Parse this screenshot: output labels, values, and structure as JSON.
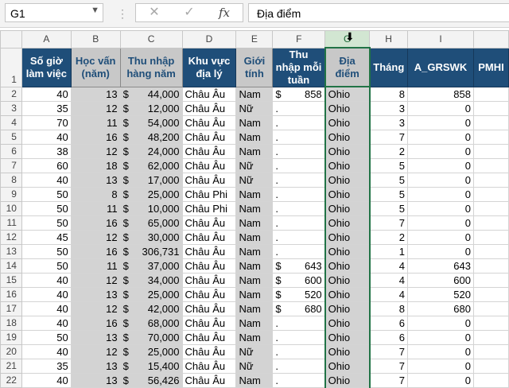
{
  "name_box": {
    "value": "G1"
  },
  "formula_bar": {
    "value": "Địa điểm",
    "fx_label": "fx",
    "cancel_icon": "cancel-x-icon",
    "enter_icon": "check-icon"
  },
  "column_letters": [
    "A",
    "B",
    "C",
    "D",
    "E",
    "F",
    "G",
    "H",
    "I",
    ""
  ],
  "selected_column": "G",
  "headers": [
    "Số giờ làm việc",
    "Học vấn (năm)",
    "Thu nhập hàng năm",
    "Khu vực địa lý",
    "Giới tính",
    "Thu nhập mỗi tuần",
    "Địa điểm",
    "Tháng",
    "A_GRSWK",
    "PMHI"
  ],
  "colors": {
    "header_bg": "#1f4e79",
    "gray_col_bg": "#d3d3d3",
    "selection": "#217346"
  },
  "rows": [
    {
      "num": "2",
      "a": "40",
      "b": "13",
      "c_sym": "$",
      "c": "44,000",
      "d": "Châu Âu",
      "e": "Nam",
      "f_sym": "$",
      "f": "858",
      "g": "Ohio",
      "h": "8",
      "i": "858"
    },
    {
      "num": "3",
      "a": "35",
      "b": "12",
      "c_sym": "$",
      "c": "12,000",
      "d": "Châu Âu",
      "e": "Nữ",
      "f_sym": "",
      "f": ".",
      "g": "Ohio",
      "h": "3",
      "i": "0"
    },
    {
      "num": "4",
      "a": "70",
      "b": "11",
      "c_sym": "$",
      "c": "54,000",
      "d": "Châu Âu",
      "e": "Nam",
      "f_sym": "",
      "f": ".",
      "g": "Ohio",
      "h": "3",
      "i": "0"
    },
    {
      "num": "5",
      "a": "40",
      "b": "16",
      "c_sym": "$",
      "c": "48,200",
      "d": "Châu Âu",
      "e": "Nam",
      "f_sym": "",
      "f": ".",
      "g": "Ohio",
      "h": "7",
      "i": "0"
    },
    {
      "num": "6",
      "a": "38",
      "b": "12",
      "c_sym": "$",
      "c": "24,000",
      "d": "Châu Âu",
      "e": "Nam",
      "f_sym": "",
      "f": ".",
      "g": "Ohio",
      "h": "2",
      "i": "0"
    },
    {
      "num": "7",
      "a": "60",
      "b": "18",
      "c_sym": "$",
      "c": "62,000",
      "d": "Châu Âu",
      "e": "Nữ",
      "f_sym": "",
      "f": ".",
      "g": "Ohio",
      "h": "5",
      "i": "0"
    },
    {
      "num": "8",
      "a": "40",
      "b": "13",
      "c_sym": "$",
      "c": "17,000",
      "d": "Châu Âu",
      "e": "Nữ",
      "f_sym": "",
      "f": ".",
      "g": "Ohio",
      "h": "5",
      "i": "0"
    },
    {
      "num": "9",
      "a": "50",
      "b": "8",
      "c_sym": "$",
      "c": "25,000",
      "d": "Châu Phi",
      "e": "Nam",
      "f_sym": "",
      "f": ".",
      "g": "Ohio",
      "h": "5",
      "i": "0"
    },
    {
      "num": "10",
      "a": "50",
      "b": "11",
      "c_sym": "$",
      "c": "10,000",
      "d": "Châu Phi",
      "e": "Nam",
      "f_sym": "",
      "f": ".",
      "g": "Ohio",
      "h": "5",
      "i": "0"
    },
    {
      "num": "11",
      "a": "50",
      "b": "16",
      "c_sym": "$",
      "c": "65,000",
      "d": "Châu Âu",
      "e": "Nam",
      "f_sym": "",
      "f": ".",
      "g": "Ohio",
      "h": "7",
      "i": "0"
    },
    {
      "num": "12",
      "a": "45",
      "b": "12",
      "c_sym": "$",
      "c": "30,000",
      "d": "Châu Âu",
      "e": "Nam",
      "f_sym": "",
      "f": ".",
      "g": "Ohio",
      "h": "2",
      "i": "0"
    },
    {
      "num": "13",
      "a": "50",
      "b": "16",
      "c_sym": "$",
      "c": "306,731",
      "d": "Châu Âu",
      "e": "Nam",
      "f_sym": "",
      "f": ".",
      "g": "Ohio",
      "h": "1",
      "i": "0"
    },
    {
      "num": "14",
      "a": "50",
      "b": "11",
      "c_sym": "$",
      "c": "37,000",
      "d": "Châu Âu",
      "e": "Nam",
      "f_sym": "$",
      "f": "643",
      "g": "Ohio",
      "h": "4",
      "i": "643"
    },
    {
      "num": "15",
      "a": "40",
      "b": "12",
      "c_sym": "$",
      "c": "34,000",
      "d": "Châu Âu",
      "e": "Nam",
      "f_sym": "$",
      "f": "600",
      "g": "Ohio",
      "h": "4",
      "i": "600"
    },
    {
      "num": "16",
      "a": "40",
      "b": "13",
      "c_sym": "$",
      "c": "25,000",
      "d": "Châu Âu",
      "e": "Nam",
      "f_sym": "$",
      "f": "520",
      "g": "Ohio",
      "h": "4",
      "i": "520"
    },
    {
      "num": "17",
      "a": "40",
      "b": "12",
      "c_sym": "$",
      "c": "42,000",
      "d": "Châu Âu",
      "e": "Nam",
      "f_sym": "$",
      "f": "680",
      "g": "Ohio",
      "h": "8",
      "i": "680"
    },
    {
      "num": "18",
      "a": "40",
      "b": "16",
      "c_sym": "$",
      "c": "68,000",
      "d": "Châu Âu",
      "e": "Nam",
      "f_sym": "",
      "f": ".",
      "g": "Ohio",
      "h": "6",
      "i": "0"
    },
    {
      "num": "19",
      "a": "50",
      "b": "13",
      "c_sym": "$",
      "c": "70,000",
      "d": "Châu Âu",
      "e": "Nam",
      "f_sym": "",
      "f": ".",
      "g": "Ohio",
      "h": "6",
      "i": "0"
    },
    {
      "num": "20",
      "a": "40",
      "b": "12",
      "c_sym": "$",
      "c": "25,000",
      "d": "Châu Âu",
      "e": "Nữ",
      "f_sym": "",
      "f": ".",
      "g": "Ohio",
      "h": "7",
      "i": "0"
    },
    {
      "num": "21",
      "a": "35",
      "b": "13",
      "c_sym": "$",
      "c": "15,400",
      "d": "Châu Âu",
      "e": "Nữ",
      "f_sym": "",
      "f": ".",
      "g": "Ohio",
      "h": "7",
      "i": "0"
    },
    {
      "num": "22",
      "a": "40",
      "b": "13",
      "c_sym": "$",
      "c": "56,426",
      "d": "Châu Âu",
      "e": "Nam",
      "f_sym": "",
      "f": ".",
      "g": "Ohio",
      "h": "7",
      "i": "0"
    }
  ]
}
